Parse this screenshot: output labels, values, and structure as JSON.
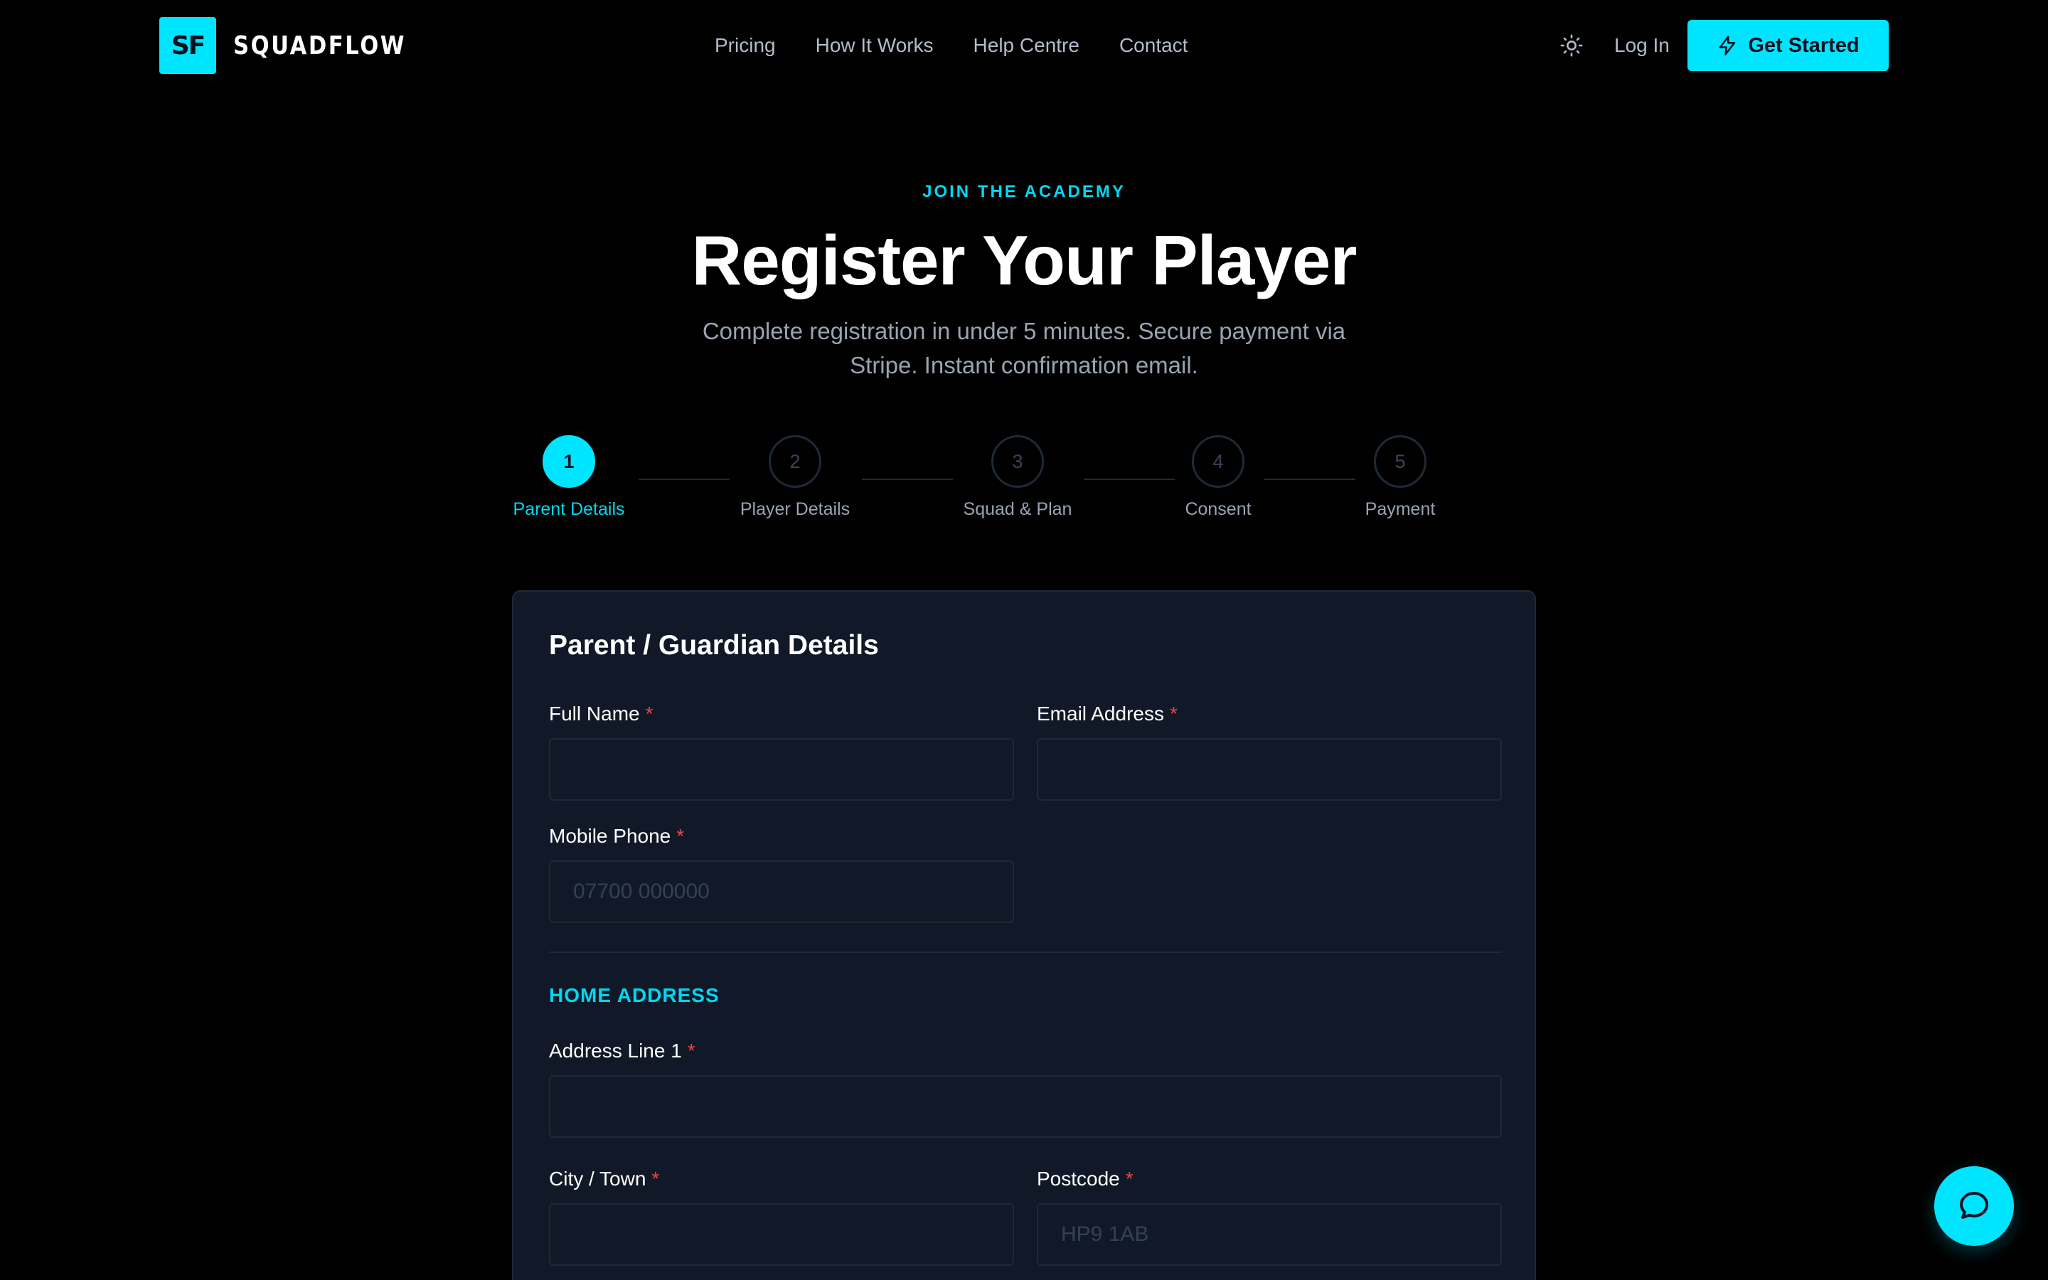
{
  "brand": {
    "badge": "SF",
    "name": "SQUADFLOW",
    "accent": "#00e5ff"
  },
  "nav": {
    "links": [
      "Pricing",
      "How It Works",
      "Help Centre",
      "Contact"
    ],
    "theme_icon": "sun-icon",
    "login_label": "Log In",
    "cta_label": "Get Started",
    "cta_icon": "lightning-icon"
  },
  "hero": {
    "eyebrow": "JOIN THE ACADEMY",
    "title": "Register Your Player",
    "subtitle": "Complete registration in under 5 minutes. Secure payment via Stripe. Instant confirmation email."
  },
  "stepper": {
    "current": 1,
    "steps": [
      {
        "number": "1",
        "label": "Parent Details"
      },
      {
        "number": "2",
        "label": "Player Details"
      },
      {
        "number": "3",
        "label": "Squad & Plan"
      },
      {
        "number": "4",
        "label": "Consent"
      },
      {
        "number": "5",
        "label": "Payment"
      }
    ]
  },
  "form": {
    "title": "Parent / Guardian Details",
    "required_mark": "*",
    "full_name": {
      "label": "Full Name",
      "value": "",
      "placeholder": ""
    },
    "email": {
      "label": "Email Address",
      "value": "",
      "placeholder": ""
    },
    "phone": {
      "label": "Mobile Phone",
      "value": "",
      "placeholder": "07700 000000"
    },
    "address_section": "HOME ADDRESS",
    "address_line1": {
      "label": "Address Line 1",
      "value": "",
      "placeholder": ""
    },
    "city": {
      "label": "City / Town",
      "value": "",
      "placeholder": ""
    },
    "postcode": {
      "label": "Postcode",
      "value": "",
      "placeholder": "HP9 1AB"
    }
  },
  "chat": {
    "icon": "chat-bubble-icon"
  }
}
